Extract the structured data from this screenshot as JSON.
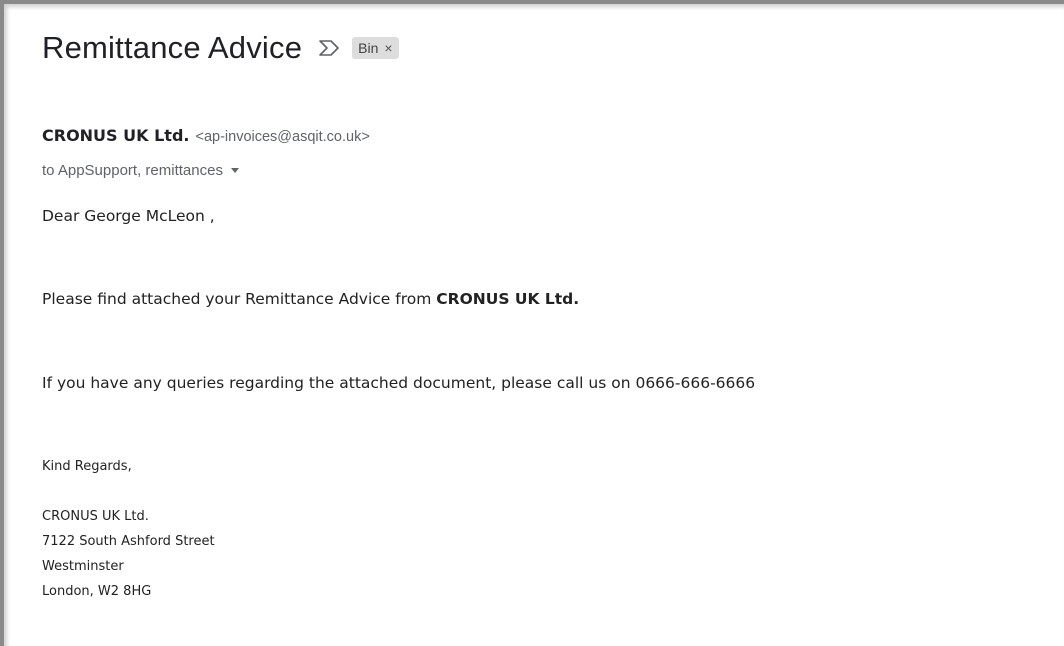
{
  "email": {
    "subject": "Remittance Advice",
    "label": {
      "text": "Bin",
      "close_glyph": "×",
      "color": "#dddddd"
    },
    "importance_icon": "importance-marker-icon",
    "sender": {
      "name": "CRONUS UK Ltd.",
      "email": "<ap-invoices@asqit.co.uk>"
    },
    "recipients": "to AppSupport, remittances",
    "body": {
      "greeting": "Dear George McLeon ,",
      "line1_prefix": "Please find attached your Remittance Advice from ",
      "line1_bold": "CRONUS UK Ltd.",
      "line2": "If you have any queries regarding the attached document, please call us on 0666-666-6666",
      "closing": "Kind Regards,",
      "signature": {
        "company": "CRONUS UK Ltd.",
        "street": "7122 South Ashford Street",
        "area": "Westminster",
        "city": "London, W2 8HG"
      }
    }
  }
}
